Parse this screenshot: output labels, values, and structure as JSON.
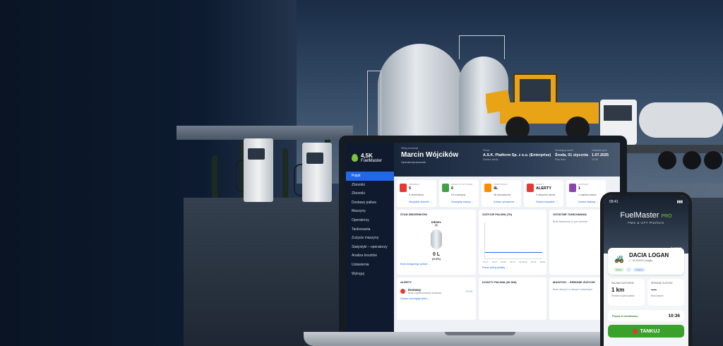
{
  "colors": {
    "accent": "#2168e8",
    "brand_green": "#7cc43a",
    "sidebar_bg": "#0f1a2e"
  },
  "sidebar": {
    "logo_top": "4,5K",
    "logo_bottom": "FuelMaster",
    "items": [
      {
        "label": "Pulpit"
      },
      {
        "label": "Zbiorniki"
      },
      {
        "label": "Zbiorniki"
      },
      {
        "label": "Dostawy paliwa"
      },
      {
        "label": "Maszyny"
      },
      {
        "label": "Operatorzy"
      },
      {
        "label": "Tankowania"
      },
      {
        "label": "Zużycie maszyny"
      },
      {
        "label": "Statystyki – operatorzy"
      },
      {
        "label": "Analiza kosztów"
      },
      {
        "label": "Ustawienia"
      },
      {
        "label": "Wyloguj"
      }
    ]
  },
  "hero": {
    "greeting": "Witaj ponownie",
    "name": "Marcin Wójcików",
    "role": "Operator/pracownik",
    "company_label": "Firma",
    "company": "A.S.K. Platform Sp. z o.o. (Enterprise)",
    "company_sub": "Zobacz alerty",
    "day_label": "Dzisiejszy dzień",
    "day": "Środa, 01 stycznia",
    "day_sub": "Plan dnia",
    "date_label": "Ostatnia sync",
    "date": "1.07.2025",
    "date_sub": "10:36"
  },
  "stats": [
    {
      "label": "ZBIORNIKI",
      "value": "5",
      "sub": "5 zbiorników",
      "link": "Wszystkie zbiorniki →",
      "color": "#e53935"
    },
    {
      "label": "MASZYNY AKTYWNE",
      "value": "6",
      "sub": "24 maszyny",
      "link": "Szczegóły maszyn →",
      "color": "#43a047"
    },
    {
      "label": "OPERATORZY",
      "value": "4L",
      "sub": "48 operatorów",
      "link": "Zobacz operatorów →",
      "color": "#fb8c00"
    },
    {
      "label": "ALERTY",
      "value": "ALERTY",
      "sub": "2 aktywne alerty",
      "link": "Zobacz wszystkie →",
      "color": "#e53935"
    },
    {
      "label": "DOSTAWY",
      "value": "1",
      "sub": "1 zaplanowana",
      "link": "Zobacz dostawy →",
      "color": "#8e44ad"
    }
  ],
  "panels": {
    "tanks_title": "STAN ZBIORNIKÓW",
    "tank_name": "DIESEL",
    "tank_id": "(B)",
    "tank_value": "0 L",
    "tank_pct": "(0.0%)",
    "tank_link": "Brak dostępnego paliwa →",
    "usage_title": "ZUŻYCIE PALIWA (7D)",
    "usage_link": "Pokaż pełną analizę →",
    "x_ticks": [
      "01.27",
      "03.27",
      "05.06",
      "05.12",
      "15.05.06",
      "20.06",
      "30.06"
    ],
    "last_title": "OSTATNIE TANKOWANIA",
    "last_empty": "Brak tankowań w tym okresie",
    "alerts_title": "ALERTY",
    "alert_name": "Dostawy",
    "alert_desc": "Brak zaplanowanej dostawy",
    "alert_time": "12:19",
    "alert_link": "Zobacz szczegóły alertu →",
    "cost_title": "KOSZTY PALIWA (30 DNI)",
    "machines_title": "MASZYNY – ŚREDNIE ZUŻYCIE",
    "machines_empty": "Brak danych w danym czasowym"
  },
  "phone": {
    "time": "09:41",
    "title": "FuelMaster",
    "title_pro": "PRO",
    "subtitle": "FMS & UTT Platform",
    "banner": "Koparka",
    "car": "DACIA LOGAN",
    "car_sub": "1 · 8L2A4G3 (magik)",
    "chips": [
      "Online",
      "•",
      "Krótkimi"
    ],
    "mini1_label": "PALIWA DOSTĘPNE",
    "mini1_value": "1 km",
    "mini1_sub": "Średnie zużycie paliwa",
    "mini2_label": "ŚREDNIE ZUŻYCIE",
    "mini2_value": "—",
    "mini2_sub": "Brak danych",
    "time_label": "Praca w terminarzu",
    "time_value": "10:36",
    "button": "TANKUJ"
  }
}
